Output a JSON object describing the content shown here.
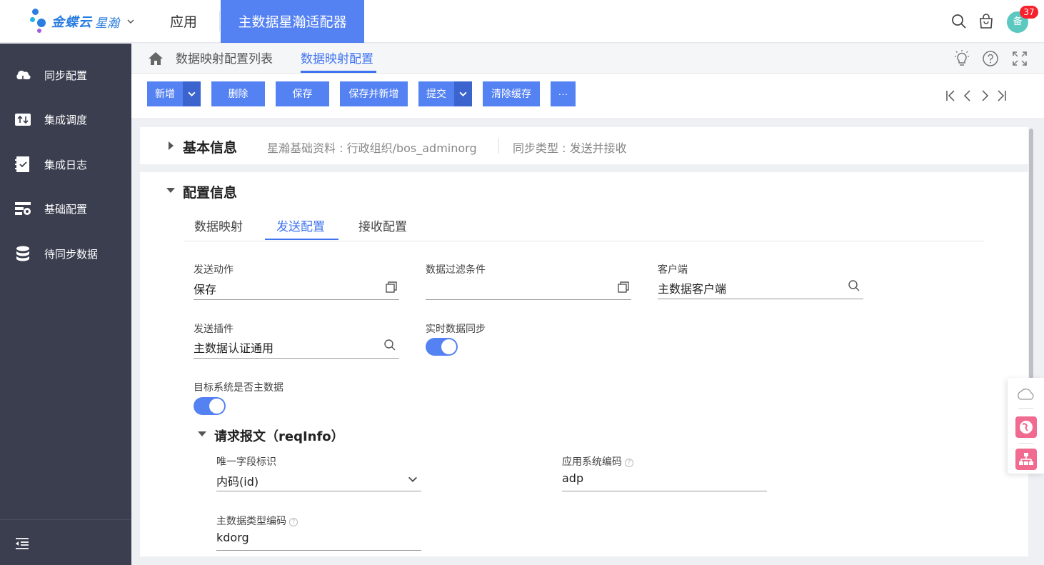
{
  "header": {
    "logo_text": "金蝶云",
    "logo_text2": "星瀚",
    "nav_app": "应用",
    "nav_active": "主数据星瀚适配器",
    "avatar_initial": "备",
    "badge_count": "37"
  },
  "sidebar": {
    "items": [
      {
        "label": "同步配置",
        "icon": "cloud-sync-icon"
      },
      {
        "label": "集成调度",
        "icon": "transfer-icon"
      },
      {
        "label": "集成日志",
        "icon": "log-check-icon"
      },
      {
        "label": "基础配置",
        "icon": "settings-list-icon"
      },
      {
        "label": "待同步数据",
        "icon": "database-icon"
      }
    ]
  },
  "breadcrumb": {
    "list": "数据映射配置列表",
    "current": "数据映射配置"
  },
  "toolbar": {
    "new": "新增",
    "delete": "删除",
    "save": "保存",
    "save_new": "保存并新增",
    "submit": "提交",
    "clear_cache": "清除缓存",
    "more": "···"
  },
  "basic_info": {
    "title": "基本信息",
    "base_data": "星瀚基础资料 : 行政组织/bos_adminorg",
    "sync_type": "同步类型 : 发送并接收"
  },
  "config_info": {
    "title": "配置信息",
    "tabs": [
      "数据映射",
      "发送配置",
      "接收配置"
    ],
    "active_tab": "发送配置",
    "fields": {
      "send_action": {
        "label": "发送动作",
        "value": "保存"
      },
      "filter": {
        "label": "数据过滤条件",
        "value": ""
      },
      "client": {
        "label": "客户端",
        "value": "主数据客户端"
      },
      "plugin": {
        "label": "发送插件",
        "value": "主数据认证通用"
      },
      "realtime": {
        "label": "实时数据同步",
        "on": true
      },
      "target_master": {
        "label": "目标系统是否主数据",
        "on": true
      }
    }
  },
  "request": {
    "title": "请求报文（reqInfo）",
    "unique_field": {
      "label": "唯一字段标识",
      "value": "内码(id)"
    },
    "app_code": {
      "label": "应用系统编码",
      "value": "adp"
    },
    "type_code": {
      "label": "主数据类型编码",
      "value": "kdorg"
    },
    "help_glyph": "?"
  },
  "colors": {
    "accent": "#5582f3",
    "sidebar": "#3a3e4f",
    "link": "#3f73ef"
  }
}
